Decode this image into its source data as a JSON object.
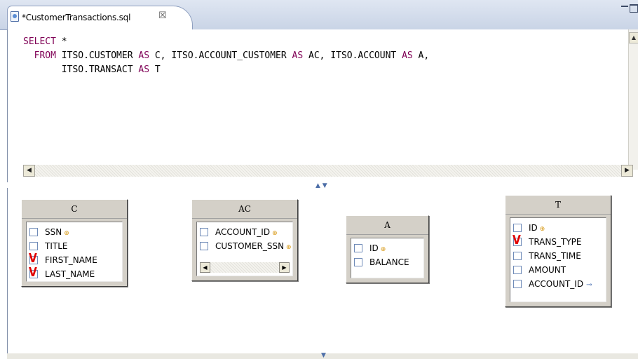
{
  "tab": {
    "title": "*CustomerTransactions.sql",
    "close_glyph": "☒"
  },
  "editor": {
    "line1_kw": "SELECT",
    "line1_rest": " *",
    "line2_indent": "  ",
    "line2_kw1": "FROM",
    "line2_a": " ITSO.CUSTOMER ",
    "as": "AS",
    "line2_b": " C, ITSO.ACCOUNT_CUSTOMER ",
    "line2_c": " AC, ITSO.ACCOUNT ",
    "line2_d": " A,",
    "line3_indent": "       ",
    "line3_a": "ITSO.TRANSACT ",
    "line3_b": " T"
  },
  "tables": {
    "c": {
      "alias": "C",
      "columns": [
        {
          "name": "SSN",
          "checked": false,
          "icon": "key-icon"
        },
        {
          "name": "TITLE",
          "checked": false
        },
        {
          "name": "FIRST_NAME",
          "checked": true
        },
        {
          "name": "LAST_NAME",
          "checked": true
        }
      ]
    },
    "ac": {
      "alias": "AC",
      "columns": [
        {
          "name": "ACCOUNT_ID",
          "checked": false,
          "icon": "key-icon"
        },
        {
          "name": "CUSTOMER_SSN",
          "checked": false,
          "icon": "key-icon"
        }
      ]
    },
    "a": {
      "alias": "A",
      "columns": [
        {
          "name": "ID",
          "checked": false,
          "icon": "key-icon"
        },
        {
          "name": "BALANCE",
          "checked": false
        }
      ]
    },
    "t": {
      "alias": "T",
      "columns": [
        {
          "name": "ID",
          "checked": false,
          "icon": "key-icon"
        },
        {
          "name": "TRANS_TYPE",
          "checked": true
        },
        {
          "name": "TRANS_TIME",
          "checked": false
        },
        {
          "name": "AMOUNT",
          "checked": false
        },
        {
          "name": "ACCOUNT_ID",
          "checked": false,
          "icon": "foreign-key-icon"
        }
      ]
    }
  },
  "glyphs": {
    "check": "V",
    "key": "⊕",
    "fk": "⊸",
    "left_arrow": "◀",
    "right_arrow": "▶",
    "up_arrow": "▲",
    "split_glyph": "▲ ▼",
    "down_glyph": "▼"
  },
  "colors": {
    "keyword": "#7f0055",
    "check": "#e00000",
    "tab_gradient_top": "#dfe6f2"
  }
}
